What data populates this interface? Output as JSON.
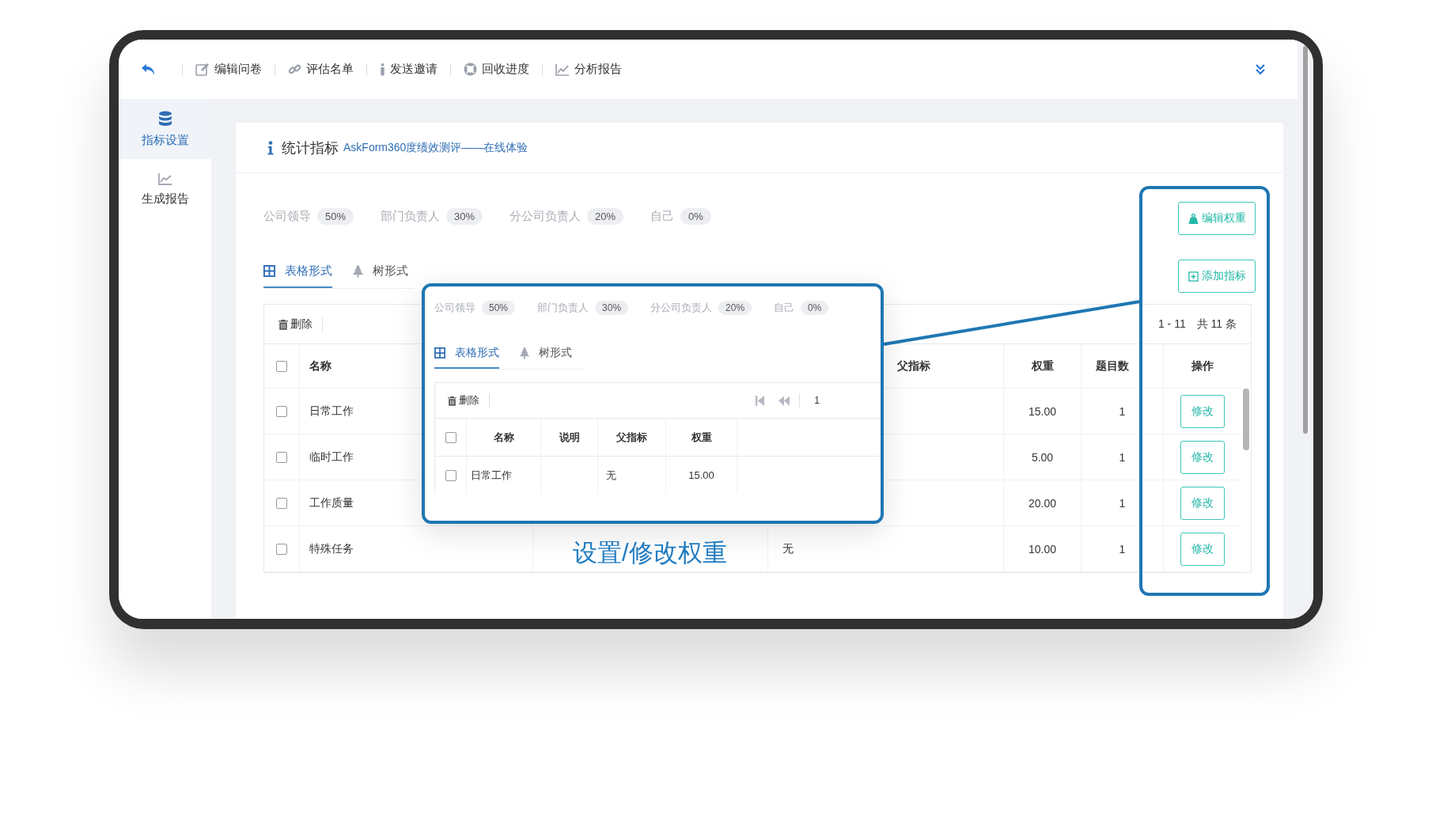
{
  "toolbar": {
    "items": [
      {
        "label": "编辑问卷",
        "kind": "edit"
      },
      {
        "label": "评估名单",
        "kind": "link"
      },
      {
        "label": "发送邀请",
        "kind": "person"
      },
      {
        "label": "回收进度",
        "kind": "lifebuoy"
      },
      {
        "label": "分析报告",
        "kind": "chart"
      }
    ]
  },
  "sidebar": {
    "items": [
      {
        "label": "指标设置",
        "kind": "database",
        "selected": true
      },
      {
        "label": "生成报告",
        "kind": "chart",
        "selected": false
      }
    ]
  },
  "header": {
    "title": "统计指标",
    "subtitle": "AskForm360度绩效测评——在线体验"
  },
  "weights": [
    {
      "label": "公司领导",
      "value": "50%"
    },
    {
      "label": "部门负责人",
      "value": "30%"
    },
    {
      "label": "分公司负责人",
      "value": "20%"
    },
    {
      "label": "自己",
      "value": "0%"
    }
  ],
  "view_tabs": [
    {
      "label": "表格形式",
      "kind": "grid",
      "selected": true
    },
    {
      "label": "树形式",
      "kind": "tree",
      "selected": false
    }
  ],
  "actions": [
    {
      "label": "编辑权重",
      "kind": "weight"
    },
    {
      "label": "添加指标",
      "kind": "add"
    }
  ],
  "table": {
    "delete_label": "删除",
    "pagination": "1 - 11　共 11 条",
    "all_checked": false,
    "columns": {
      "name": "名称",
      "parent": "父指标",
      "weight": "权重",
      "count": "题目数",
      "action": "操作"
    },
    "rows": [
      {
        "checked": false,
        "name": "日常工作",
        "weight": "15.00",
        "count": "1",
        "action": "修改"
      },
      {
        "checked": false,
        "name": "临时工作",
        "weight": "5.00",
        "count": "1",
        "action": "修改"
      },
      {
        "checked": false,
        "name": "工作质量",
        "weight": "20.00",
        "count": "1",
        "action": "修改"
      },
      {
        "checked": false,
        "name": "特殊任务",
        "parent": "无",
        "weight": "10.00",
        "count": "1",
        "action": "修改"
      }
    ]
  },
  "callout": {
    "weights": [
      {
        "label": "公司领导",
        "value": "50%"
      },
      {
        "label": "部门负责人",
        "value": "30%"
      },
      {
        "label": "分公司负责人",
        "value": "20%"
      },
      {
        "label": "自己",
        "value": "0%"
      }
    ],
    "view_tabs": [
      {
        "label": "表格形式",
        "kind": "grid",
        "selected": true
      },
      {
        "label": "树形式",
        "kind": "tree",
        "selected": false
      }
    ],
    "delete_label": "删除",
    "page": "1",
    "all_checked": false,
    "columns": [
      "名称",
      "说明",
      "父指标",
      "权重"
    ],
    "rows": [
      {
        "checked": false,
        "name": "日常工作",
        "parent": "无",
        "weight": "15.00"
      }
    ]
  },
  "caption": "设置/修改权重"
}
